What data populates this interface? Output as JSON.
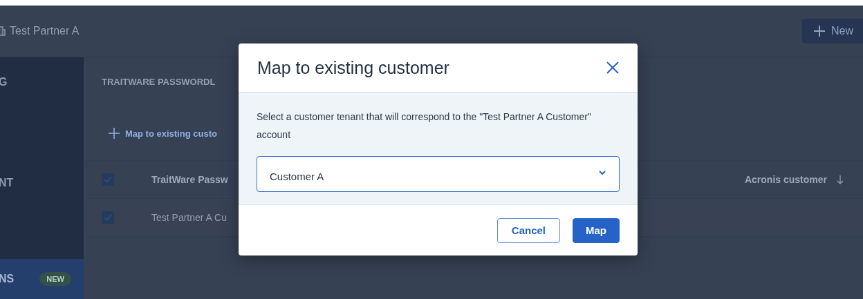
{
  "header": {
    "title": "Test Partner A",
    "new_button": "New"
  },
  "sidebar": {
    "items": [
      {
        "label": "G",
        "selected": false
      },
      {
        "label": "NT",
        "selected": false
      },
      {
        "label": "NS",
        "badge": "NEW",
        "selected": true
      }
    ]
  },
  "content": {
    "heading": "TRAITWARE PASSWORDL",
    "map_link": "Map to existing custo",
    "table": {
      "header_checked": true,
      "columns": [
        "TraitWare Passw",
        "Acronis customer"
      ],
      "rows": [
        {
          "checked": true,
          "cells": [
            "Test Partner A Cu",
            ""
          ]
        }
      ]
    }
  },
  "modal": {
    "title": "Map to existing customer",
    "message": "Select a customer tenant that will correspond to the \"Test Partner A Customer\" account",
    "select": {
      "value": "Customer A"
    },
    "buttons": [
      {
        "label": "Cancel",
        "kind": "secondary"
      },
      {
        "label": "Map",
        "kind": "primary"
      }
    ]
  }
}
